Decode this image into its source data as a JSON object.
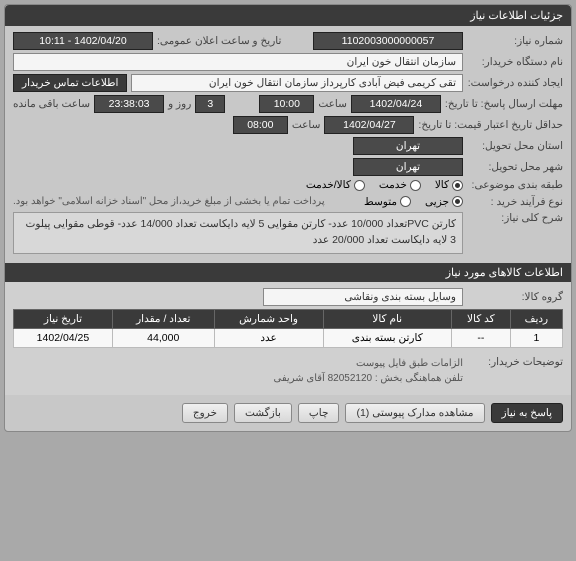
{
  "headers": {
    "main": "جزئیات اطلاعات نیاز",
    "goods": "اطلاعات کالاهای مورد نیاز"
  },
  "labels": {
    "need_no": "شماره نیاز:",
    "buyer_org": "نام دستگاه خریدار:",
    "requester": "ایجاد کننده درخواست:",
    "reply_deadline": "مهلت ارسال پاسخ: تا تاریخ:",
    "credit_until": "حداقل تاریخ اعتبار قیمت: تا تاریخ:",
    "location": "استان محل تحویل:",
    "city": "شهر محل تحویل:",
    "subject_cat": "طبقه بندی موضوعی:",
    "buy_process": "نوع فرآیند خرید :",
    "general_desc": "شرح کلی نیاز:",
    "goods_group": "گروه کالا:",
    "buyer_notes": "توضیحات خریدار:",
    "announce_date": "تاریخ و ساعت اعلان عمومی:",
    "time": "ساعت",
    "day_and": "روز و",
    "remaining": "ساعت باقی مانده",
    "contact_btn": "اطلاعات تماس خریدار"
  },
  "values": {
    "need_no": "1102003000000057",
    "buyer_org": "سازمان انتقال خون ایران",
    "requester": "تقی  کریمی فیض آبادی کارپرداز سازمان انتقال خون ایران",
    "reply_date": "1402/04/24",
    "reply_time": "10:00",
    "reply_days": "3",
    "reply_countdown": "23:38:03",
    "credit_date": "1402/04/27",
    "credit_time": "08:00",
    "province": "تهران",
    "city": "تهران",
    "announce": "1402/04/20 - 10:11",
    "payment_note": "پرداخت تمام یا بخشی از مبلغ خرید،از محل \"اسناد خزانه اسلامی\" خواهد بود.",
    "desc": "کارتن PVCتعداد 10/000 عدد- کارتن مقوایی 5 لایه دایکاست تعداد 14/000 عدد- قوطی مقوایی پیلوت 3 لایه دایکاست تعداد 20/000 عدد",
    "goods_group": "وسایل بسته بندی  ونقاشی",
    "buyer_notes_l1": "الزامات طبق فایل پیوست",
    "buyer_notes_l2": "تلفن هماهنگی بخش : 82052120 آقای شریفی"
  },
  "radios": {
    "cat": {
      "opt_goods": "کالا",
      "opt_service": "خدمت",
      "opt_both": "کالا/خدمت"
    },
    "process": {
      "opt_minor": "جزیی",
      "opt_medium": "متوسط"
    }
  },
  "table": {
    "cols": {
      "row": "ردیف",
      "code": "کد کالا",
      "name": "نام کالا",
      "unit": "واحد شمارش",
      "qty": "تعداد / مقدار",
      "date": "تاریخ نیاز"
    },
    "rows": [
      {
        "row": "1",
        "code": "--",
        "name": "کارتن بسته بندی",
        "unit": "عدد",
        "qty": "44,000",
        "date": "1402/04/25"
      }
    ]
  },
  "buttons": {
    "respond": "پاسخ به نیاز",
    "attachments": "مشاهده مدارک پیوستی (1)",
    "print": "چاپ",
    "back": "بازگشت",
    "exit": "خروج"
  }
}
